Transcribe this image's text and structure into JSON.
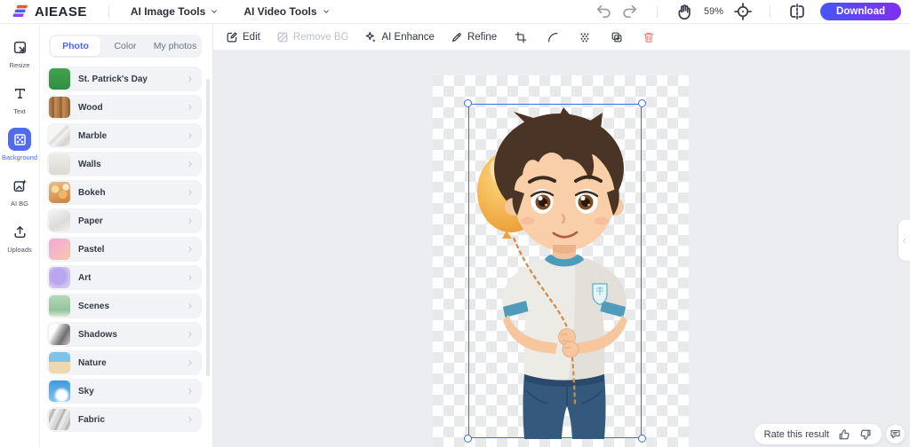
{
  "header": {
    "logo_text": "AIEASE",
    "nav": [
      {
        "id": "ai-image-tools",
        "label": "AI Image Tools",
        "icon": "chevron-down-icon"
      },
      {
        "id": "ai-video-tools",
        "label": "AI Video Tools",
        "icon": "chevron-down-icon"
      }
    ],
    "zoom_level": "59%",
    "download_label": "Download"
  },
  "sidebar": {
    "items": [
      {
        "id": "resize",
        "label": "Resize",
        "icon": "resize-icon",
        "active": false
      },
      {
        "id": "text",
        "label": "Text",
        "icon": "text-icon",
        "active": false
      },
      {
        "id": "background",
        "label": "Background",
        "icon": "background-icon",
        "active": true
      },
      {
        "id": "ai-bg",
        "label": "AI BG",
        "icon": "ai-bg-icon",
        "active": false
      },
      {
        "id": "uploads",
        "label": "Uploads",
        "icon": "upload-icon",
        "active": false
      }
    ]
  },
  "panel": {
    "tabs": [
      {
        "id": "photo",
        "label": "Photo",
        "active": true
      },
      {
        "id": "color",
        "label": "Color",
        "active": false
      },
      {
        "id": "my-photos",
        "label": "My photos",
        "active": false
      }
    ],
    "categories": [
      {
        "label": "St. Patrick's Day",
        "thumb": "st-patricks"
      },
      {
        "label": "Wood",
        "thumb": "wood"
      },
      {
        "label": "Marble",
        "thumb": "marble"
      },
      {
        "label": "Walls",
        "thumb": "walls"
      },
      {
        "label": "Bokeh",
        "thumb": "bokeh"
      },
      {
        "label": "Paper",
        "thumb": "paper"
      },
      {
        "label": "Pastel",
        "thumb": "pastel"
      },
      {
        "label": "Art",
        "thumb": "art"
      },
      {
        "label": "Scenes",
        "thumb": "scenes"
      },
      {
        "label": "Shadows",
        "thumb": "shadows"
      },
      {
        "label": "Nature",
        "thumb": "nature"
      },
      {
        "label": "Sky",
        "thumb": "sky"
      },
      {
        "label": "Fabric",
        "thumb": "fabric"
      }
    ]
  },
  "toolbar": {
    "buttons": [
      {
        "id": "edit",
        "label": "Edit",
        "icon": "edit-icon",
        "disabled": false
      },
      {
        "id": "remove-bg",
        "label": "Remove BG",
        "icon": "remove-bg-icon",
        "disabled": true
      },
      {
        "id": "ai-enhance",
        "label": "AI Enhance",
        "icon": "sparkle-icon",
        "disabled": false
      },
      {
        "id": "refine",
        "label": "Refine",
        "icon": "pen-icon",
        "disabled": false
      }
    ],
    "icon_buttons": [
      {
        "id": "crop",
        "icon": "crop-icon",
        "danger": false
      },
      {
        "id": "arc",
        "icon": "arc-icon",
        "danger": false
      },
      {
        "id": "dissolve",
        "icon": "dissolve-icon",
        "danger": false
      },
      {
        "id": "duplicate",
        "icon": "duplicate-icon",
        "danger": false
      },
      {
        "id": "delete",
        "icon": "trash-icon",
        "danger": true
      }
    ]
  },
  "footer": {
    "rate_label": "Rate this result"
  },
  "colors": {
    "accent": "#4a66f0",
    "selection": "#3f6ede",
    "danger": "#ee8585",
    "download_gradient_start": "#4955f8",
    "download_gradient_end": "#7e30f2"
  }
}
